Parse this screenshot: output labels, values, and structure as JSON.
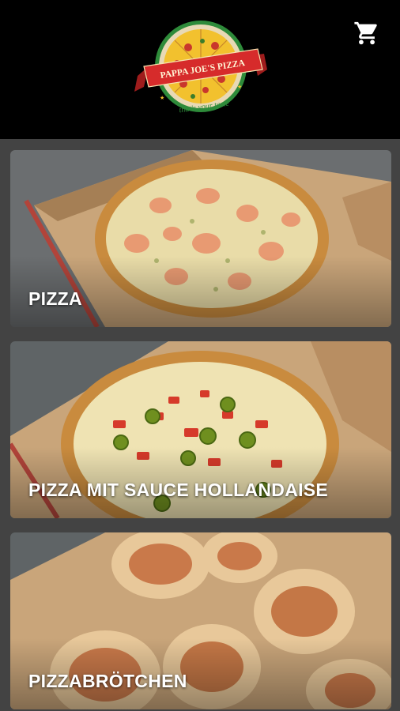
{
  "brand": {
    "name": "PAPPA JOE'S PIZZA",
    "tagline": "that's your taste"
  },
  "header": {
    "cart_icon": "shopping-cart-icon"
  },
  "categories": [
    {
      "label": "PIZZA"
    },
    {
      "label": "PIZZA MIT SAUCE HOLLANDAISE"
    },
    {
      "label": "PIZZABRÖTCHEN"
    }
  ],
  "colors": {
    "header_bg": "#000000",
    "page_bg": "#434343",
    "logo_red": "#d62b2b",
    "logo_green": "#2e8b3a",
    "logo_yellow": "#f2c12e",
    "text": "#ffffff"
  }
}
